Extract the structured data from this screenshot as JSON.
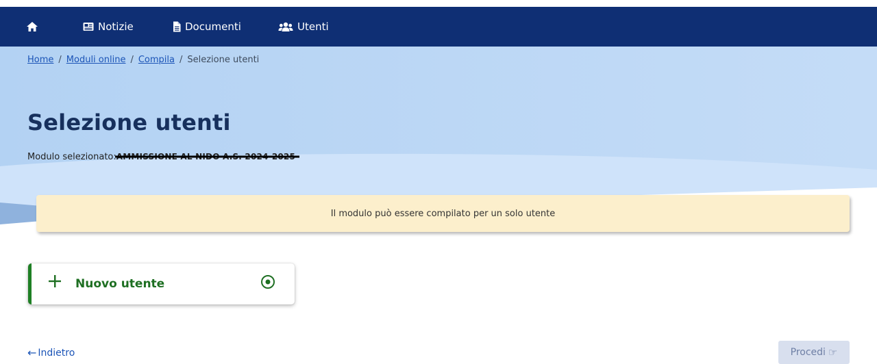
{
  "nav": {
    "home_icon": "home-icon",
    "items": [
      {
        "label": "Notizie",
        "icon": "newspaper-icon"
      },
      {
        "label": "Documenti",
        "icon": "document-icon"
      },
      {
        "label": "Utenti",
        "icon": "users-icon"
      }
    ]
  },
  "breadcrumb": {
    "items": [
      "Home",
      "Moduli online",
      "Compila"
    ],
    "separator": "/",
    "current": "Selezione utenti"
  },
  "page": {
    "title": "Selezione utenti",
    "module_label": "Modulo selezionato:",
    "module_name": "AMMISSIONE AL NIDO A.S. 2024-2025"
  },
  "alert": {
    "message": "Il modulo può essere compilato per un solo utente"
  },
  "user_option": {
    "label": "Nuovo utente",
    "icon": "plus-icon",
    "selected": true
  },
  "footer": {
    "back_label": "Indietro",
    "back_icon": "arrow-left-icon",
    "proceed_label": "Procedi",
    "proceed_icon": "pointing-hand-icon"
  },
  "colors": {
    "navbar": "#0f2f74",
    "hero_blue": "#b8d6f5",
    "title": "#17305d",
    "link": "#1b54b7",
    "alert_bg": "#fcefcc",
    "accent_green": "#1e7f24",
    "proceed_bg": "#d8dfee"
  }
}
